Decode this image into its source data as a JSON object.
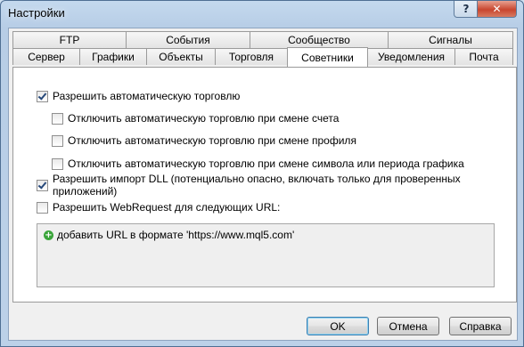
{
  "window": {
    "title": "Настройки"
  },
  "titlebar": {
    "help_label": "?",
    "close_label": "✕"
  },
  "tabs_row1": [
    "FTP",
    "События",
    "Сообщество",
    "Сигналы"
  ],
  "tabs_row2": [
    "Сервер",
    "Графики",
    "Объекты",
    "Торговля",
    "Советники",
    "Уведомления",
    "Почта"
  ],
  "active_tab": "Советники",
  "options": {
    "auto_trading": {
      "label": "Разрешить автоматическую торговлю",
      "checked": true
    },
    "disable_on_account": {
      "label": "Отключить автоматическую торговлю при смене счета",
      "checked": false
    },
    "disable_on_profile": {
      "label": "Отключить автоматическую торговлю при смене профиля",
      "checked": false
    },
    "disable_on_symbol": {
      "label": "Отключить автоматическую торговлю при смене символа или периода графика",
      "checked": false
    },
    "dll_import": {
      "label": "Разрешить импорт DLL (потенциально опасно, включать только для проверенных приложений)",
      "checked": true
    },
    "webrequest": {
      "label": "Разрешить WebRequest для следующих URL:",
      "checked": false
    }
  },
  "url_list": {
    "add_item": "добавить URL в формате 'https://www.mql5.com'"
  },
  "buttons": {
    "ok": "OK",
    "cancel": "Отмена",
    "help": "Справка"
  }
}
